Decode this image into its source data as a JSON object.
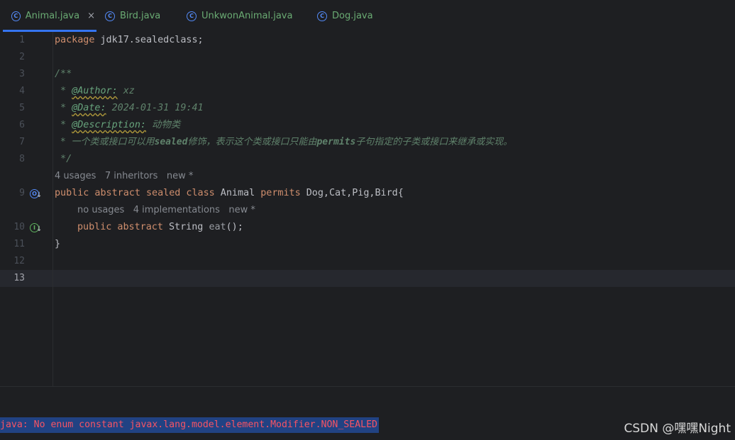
{
  "tabs": [
    {
      "label": "Animal.java",
      "icon": "class-icon",
      "active": true
    },
    {
      "label": "Bird.java",
      "icon": "class-icon"
    },
    {
      "label": "UnkwonAnimal.java",
      "icon": "class-icon"
    },
    {
      "label": "Dog.java",
      "icon": "class-icon"
    }
  ],
  "tab_close": "×",
  "icon_letter": "C",
  "line_numbers": [
    "1",
    "2",
    "3",
    "4",
    "5",
    "6",
    "7",
    "8",
    "9",
    "10",
    "11",
    "12",
    "13"
  ],
  "current_line": "13",
  "code": {
    "l1_kw": "package",
    "l1_rest": " jdk17.sealedclass;",
    "l3": "/**",
    "l4_star": " * ",
    "l4_tag": "@Author:",
    "l4_val": " xz",
    "l5_star": " * ",
    "l5_tag": "@Date:",
    "l5_val": " 2024-01-31 19:41",
    "l6_star": " * ",
    "l6_tag": "@Description:",
    "l6_val": " 动物类",
    "l7_star": " * ",
    "l7_a": "一个类或接口可以用",
    "l7_b": "sealed",
    "l7_c": "修饰，表示这个类或接口只能由",
    "l7_d": "permits",
    "l7_e": "子句指定的子类或接口来继承或实现。",
    "l8": " */",
    "l9_kw": "public abstract sealed class",
    "l9_name": " Animal ",
    "l9_kw2": "permits",
    "l9_rest": " Dog,Cat,Pig,Bird{",
    "l10_kw": "public abstract",
    "l10_type": " String ",
    "l10_m": "eat",
    "l10_rest": "();",
    "l11": "}"
  },
  "hints": {
    "class_usages": "4 usages",
    "class_inheritors": "7 inheritors",
    "class_new": "new *",
    "method_usages": "no usages",
    "method_impls": "4 implementations",
    "method_new": "new *"
  },
  "gutter_icons": {
    "line9": "overridden-icon",
    "line10": "implemented-icon",
    "o_letter": "O",
    "i_letter": "I"
  },
  "status_error": "java: No enum constant javax.lang.model.element.Modifier.NON_SEALED",
  "watermark": "CSDN @嘿嘿Night",
  "colors": {
    "keyword": "#cf8e6d",
    "comment": "#7a7e85",
    "doc_tag": "#67a37c",
    "error": "#f75464",
    "tab_accent": "#3574f0"
  }
}
